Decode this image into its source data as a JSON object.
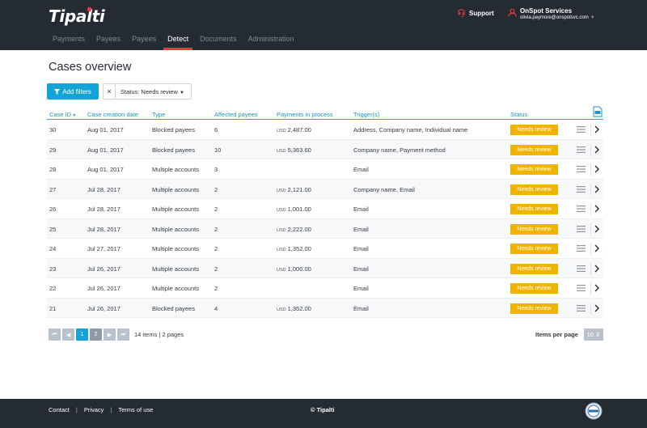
{
  "header": {
    "logo": "Tipalti",
    "support_label": "Support",
    "account_name": "OnSpot Services",
    "account_email": "olivia.paymore@onspotsvc.com"
  },
  "nav": [
    {
      "label": "Payments",
      "active": false
    },
    {
      "label": "Payees",
      "active": false
    },
    {
      "label": "Payees",
      "active": false
    },
    {
      "label": "Detect",
      "active": true
    },
    {
      "label": "Documents",
      "active": false
    },
    {
      "label": "Administration",
      "active": false
    }
  ],
  "page": {
    "title": "Cases overview",
    "add_filters_label": "Add filters",
    "filter_chip_x": "×",
    "filter_chip_label": "Status: Needs review"
  },
  "table": {
    "columns": [
      "Case ID",
      "Case creation date",
      "Type",
      "Affected payees",
      "Payments in process",
      "Trigger(s)",
      "Status"
    ],
    "sort_glyph": "▾",
    "currency": "USD",
    "rows": [
      {
        "id": "30",
        "date": "Aug 01, 2017",
        "type": "Blocked payees",
        "affected": "6",
        "amount": "2,487.00",
        "triggers": "Address, Company name, Individual name",
        "status": "Needs review"
      },
      {
        "id": "29",
        "date": "Aug 01, 2017",
        "type": "Blocked payees",
        "affected": "10",
        "amount": "5,363.60",
        "triggers": "Company name, Payment method",
        "status": "Needs review"
      },
      {
        "id": "28",
        "date": "Aug 01, 2017",
        "type": "Multiple accounts",
        "affected": "3",
        "amount": "",
        "triggers": "Email",
        "status": "Needs review"
      },
      {
        "id": "27",
        "date": "Jul 28, 2017",
        "type": "Multiple accounts",
        "affected": "2",
        "amount": "2,121.00",
        "triggers": "Company name, Email",
        "status": "Needs review"
      },
      {
        "id": "26",
        "date": "Jul 28, 2017",
        "type": "Multiple accounts",
        "affected": "2",
        "amount": "1,001.00",
        "triggers": "Email",
        "status": "Needs review"
      },
      {
        "id": "25",
        "date": "Jul 28, 2017",
        "type": "Multiple accounts",
        "affected": "2",
        "amount": "2,222.00",
        "triggers": "Email",
        "status": "Needs review"
      },
      {
        "id": "24",
        "date": "Jul 27, 2017",
        "type": "Multiple accounts",
        "affected": "2",
        "amount": "1,352.00",
        "triggers": "Email",
        "status": "Needs review"
      },
      {
        "id": "23",
        "date": "Jul 26, 2017",
        "type": "Multiple accounts",
        "affected": "2",
        "amount": "1,000.00",
        "triggers": "Email",
        "status": "Needs review"
      },
      {
        "id": "22",
        "date": "Jul 26, 2017",
        "type": "Multiple accounts",
        "affected": "2",
        "amount": "",
        "triggers": "Email",
        "status": "Needs review"
      },
      {
        "id": "21",
        "date": "Jul 26, 2017",
        "type": "Blocked payees",
        "affected": "4",
        "amount": "1,352.00",
        "triggers": "Email",
        "status": "Needs review"
      }
    ]
  },
  "pagination": {
    "first": "⏮",
    "prev": "◀",
    "pages": [
      "1",
      "2"
    ],
    "current": "1",
    "next": "▶",
    "last": "⏭",
    "info": "14 items | 2 pages",
    "items_per_page_label": "Items per page",
    "items_per_page_value": "10 ⇕"
  },
  "footer": {
    "links": [
      "Contact",
      "Privacy",
      "Terms of use"
    ],
    "separator": "|",
    "copyright": "© Tipalti"
  },
  "colors": {
    "header_bg": "#252b33",
    "accent_red": "#e53a40",
    "primary_blue": "#12a4d6",
    "status_amber": "#f0b400"
  },
  "icons": [
    "support-icon",
    "user-icon",
    "filter-icon",
    "export-icon",
    "menu-icon",
    "chevron-right-icon",
    "certification-badge-icon"
  ]
}
